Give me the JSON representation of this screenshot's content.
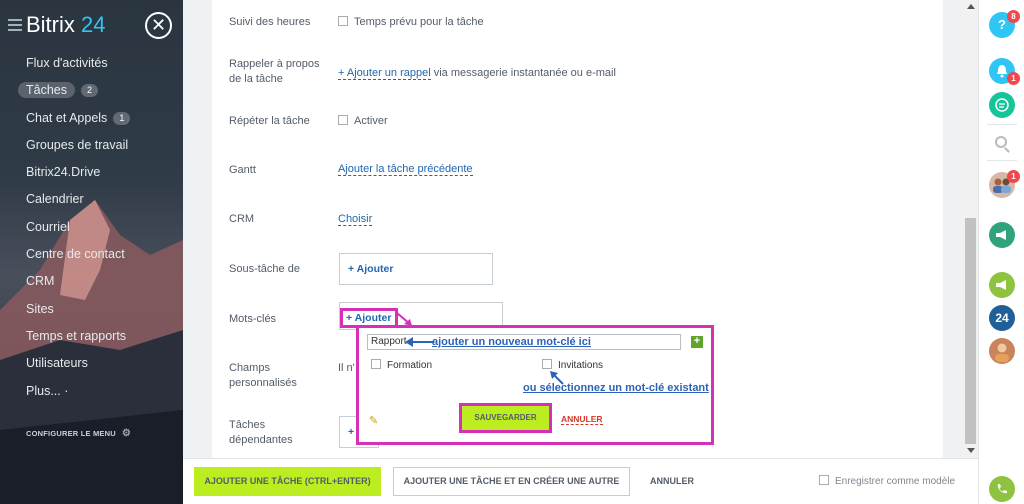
{
  "sidebar": {
    "logo_main": "Bitrix",
    "logo_num": "24",
    "items": [
      {
        "label": "Flux d'activités",
        "count": ""
      },
      {
        "label": "Tâches",
        "count": "2"
      },
      {
        "label": "Chat et Appels",
        "count": "1"
      },
      {
        "label": "Groupes de travail",
        "count": ""
      },
      {
        "label": "Bitrix24.Drive",
        "count": ""
      },
      {
        "label": "Calendrier",
        "count": ""
      },
      {
        "label": "Courriel",
        "count": ""
      },
      {
        "label": "Centre de contact",
        "count": ""
      },
      {
        "label": "CRM",
        "count": ""
      },
      {
        "label": "Sites",
        "count": ""
      },
      {
        "label": "Temps et rapports",
        "count": ""
      },
      {
        "label": "Utilisateurs",
        "count": ""
      },
      {
        "label": "Plus... ·",
        "count": ""
      }
    ],
    "configure_label": "CONFIGURER LE MENU"
  },
  "form": {
    "time_tracking": {
      "label": "Suivi des heures",
      "value": "Temps prévu pour la tâche"
    },
    "reminder": {
      "label_1": "Rappeler à propos",
      "label_2": "de la tâche",
      "link": "+ Ajouter un rappel",
      "suffix": " via messagerie instantanée ou e-mail"
    },
    "repeat": {
      "label": "Répéter la tâche",
      "value": "Activer"
    },
    "gantt": {
      "label": "Gantt",
      "link": "Ajouter la tâche précédente"
    },
    "crm": {
      "label": "CRM",
      "link": "Choisir"
    },
    "subtask": {
      "label": "Sous-tâche de",
      "add": "+ Ajouter"
    },
    "tags": {
      "label": "Mots-clés",
      "add": "+ Ajouter"
    },
    "custom_fields": {
      "label_1": "Champs",
      "label_2": "personnalisés",
      "value_fragment": "Il n'"
    },
    "dependent": {
      "label_1": "Tâches",
      "label_2": "dépendantes",
      "add_fragment": "+"
    }
  },
  "tag_popup": {
    "input_value": "Rapport",
    "annotation_new": "ajouter un nouveau mot-clé ici",
    "option_1": "Formation",
    "option_2": "Invitations",
    "annotation_existing": "ou sélectionnez un mot-clé existant",
    "save_label": "SAUVEGARDER",
    "cancel_label": "ANNULER"
  },
  "bottom": {
    "primary": "AJOUTER UNE TÂCHE (CTRL+ENTER)",
    "secondary": "AJOUTER UNE TÂCHE ET EN CRÉER UNE AUTRE",
    "cancel": "ANNULER",
    "save_template": "Enregistrer comme modèle"
  },
  "rightbar": {
    "help_badge": "8",
    "notif_badge": "1",
    "avatars_badge": "1",
    "bitrix_label": "24"
  },
  "colors": {
    "accent_green": "#bbed21",
    "annotation_magenta": "#d62fb8",
    "link_blue": "#2067b0",
    "danger_red": "#d13a28"
  }
}
